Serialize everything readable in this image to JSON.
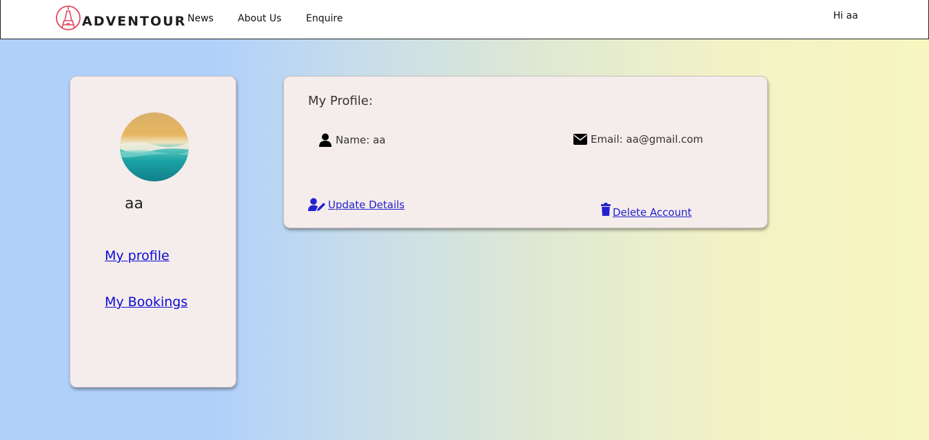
{
  "nav": {
    "brand": "ADVENTOUR",
    "links": [
      "News",
      "About Us",
      "Enquire"
    ],
    "greeting": "Hi aa"
  },
  "sidebar": {
    "username": "aa",
    "links": [
      "My profile",
      "My Bookings"
    ]
  },
  "profile": {
    "title": "My Profile:",
    "name_text": "Name: aa",
    "email_text": "Email: aa@gmail.com",
    "update_label": " Update Details",
    "delete_label": " Delete Account"
  },
  "colors": {
    "link": "#0a0ad4",
    "card_bg": "#f5ecec",
    "logo_accent": "#e0475a"
  }
}
